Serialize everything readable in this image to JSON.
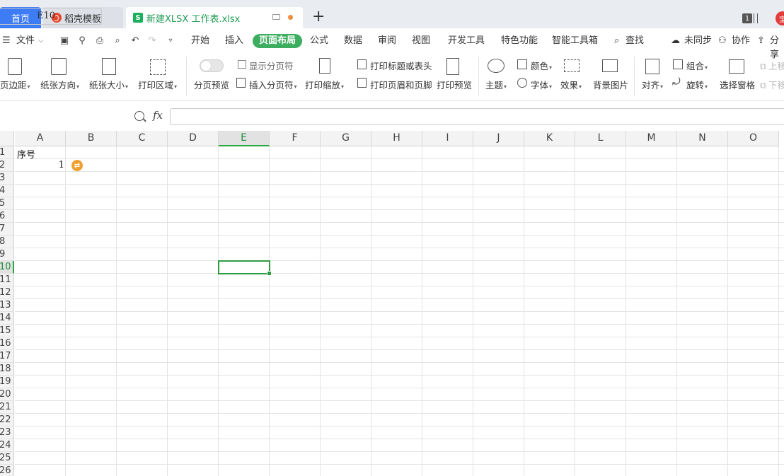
{
  "tabs": {
    "home": "首页",
    "templates": "稻壳模板",
    "file": "新建XLSX 工作表.xlsx",
    "window_count": "1",
    "avatar_initial": "宝"
  },
  "menu": {
    "file": "文件",
    "items": [
      "开始",
      "插入",
      "页面布局",
      "公式",
      "数据",
      "审阅",
      "视图",
      "开发工具",
      "特色功能",
      "智能工具箱"
    ],
    "active": "页面布局",
    "search": "查找",
    "sync": "未同步",
    "collab": "协作",
    "share": "分享"
  },
  "ribbon": {
    "margins": "页边距",
    "orientation": "纸张方向",
    "size": "纸张大小",
    "print_area": "打印区域",
    "page_break_preview": "分页预览",
    "show_page_breaks": "显示分页符",
    "insert_page_break": "插入分页符",
    "print_scaling": "打印缩放",
    "print_titles": "打印标题或表头",
    "header_footer": "打印页眉和页脚",
    "print_preview": "打印预览",
    "theme": "主题",
    "colors": "颜色",
    "fonts": "字体",
    "effects": "效果",
    "background": "背景图片",
    "align": "对齐",
    "group": "组合",
    "rotate": "旋转",
    "selection_pane": "选择窗格",
    "bring_forward": "上移",
    "send_backward": "下移"
  },
  "formula_bar": {
    "name_box": "E10",
    "fx": "fx",
    "content": ""
  },
  "grid": {
    "columns": [
      "A",
      "B",
      "C",
      "D",
      "E",
      "F",
      "G",
      "H",
      "I",
      "J",
      "K",
      "L",
      "M",
      "N",
      "O"
    ],
    "selected_column": "E",
    "rows": [
      "1",
      "2",
      "3",
      "4",
      "5",
      "6",
      "7",
      "8",
      "9",
      "10",
      "11",
      "12",
      "13",
      "14",
      "15",
      "16",
      "17",
      "18",
      "19",
      "20",
      "21",
      "22",
      "23",
      "24",
      "25",
      "26"
    ],
    "selected_row": "10",
    "cells": {
      "A1": "序号",
      "A2": "1"
    },
    "selected_cell": "E10"
  },
  "colors": {
    "accent_green": "#3cae5f",
    "home_tab_blue": "#3d7cf4"
  }
}
